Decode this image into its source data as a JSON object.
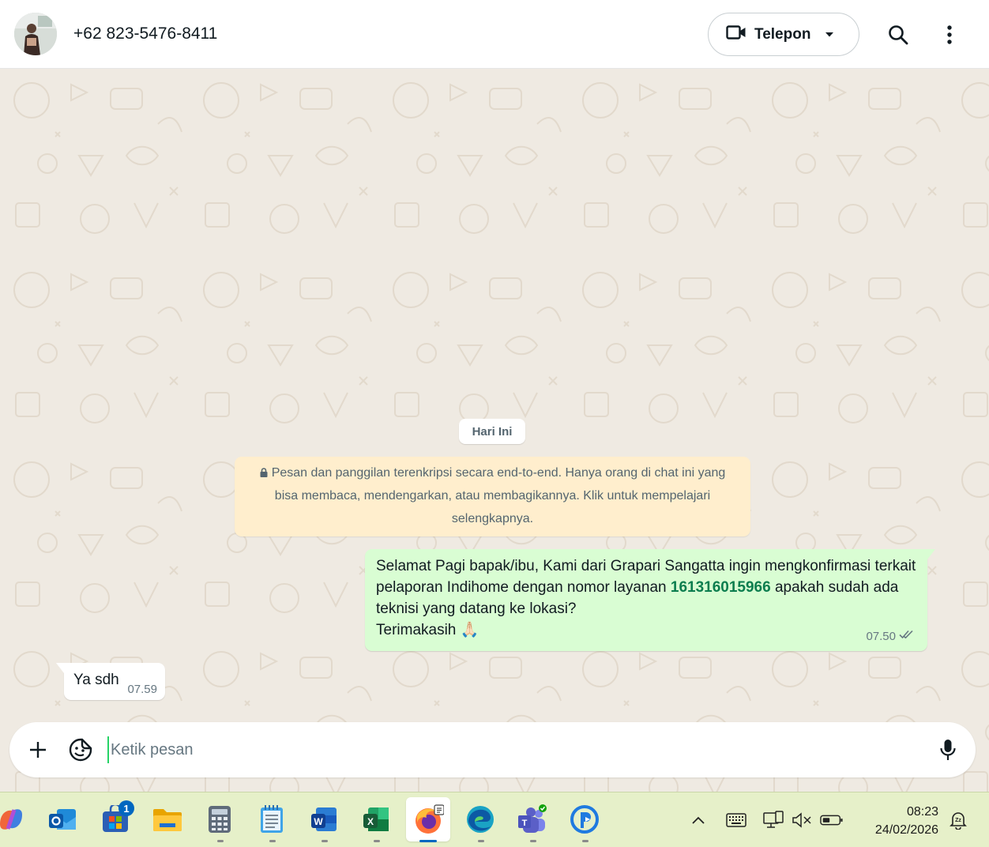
{
  "header": {
    "contact_name": "+62 823-5476-8411",
    "call_label": "Telepon"
  },
  "chat": {
    "date_chip": "Hari Ini",
    "encryption_notice": "Pesan dan panggilan terenkripsi secara end-to-end. Hanya orang di chat ini yang bisa membaca, mendengarkan, atau membagikannya. Klik untuk mempelajari selengkapnya.",
    "messages": [
      {
        "direction": "outgoing",
        "text_before": "Selamat Pagi bapak/ibu, Kami dari Grapari Sangatta ingin mengkonfirmasi terkait pelaporan Indihome dengan nomor layanan ",
        "service_number": "161316015966",
        "text_after": " apakah sudah ada teknisi yang datang ke lokasi?",
        "closing": "Terimakasih",
        "emoji": "🙏🏻",
        "time": "07.50",
        "status": "read"
      },
      {
        "direction": "incoming",
        "text": "Ya sdh",
        "time": "07.59"
      }
    ]
  },
  "composer": {
    "placeholder": "Ketik pesan"
  },
  "taskbar": {
    "apps": [
      {
        "name": "copilot"
      },
      {
        "name": "outlook"
      },
      {
        "name": "microsoft-store",
        "badge": "1"
      },
      {
        "name": "file-explorer"
      },
      {
        "name": "calculator"
      },
      {
        "name": "notepad"
      },
      {
        "name": "word"
      },
      {
        "name": "excel"
      },
      {
        "name": "firefox",
        "active": true
      },
      {
        "name": "edge"
      },
      {
        "name": "teams"
      },
      {
        "name": "app-p"
      }
    ],
    "clock_time": "08:23",
    "clock_date": "24/02/2026",
    "colors": {
      "accent": "#0067c0",
      "whatsapp_green": "#25d366",
      "outgoing_bubble": "#d9fdd3"
    }
  }
}
